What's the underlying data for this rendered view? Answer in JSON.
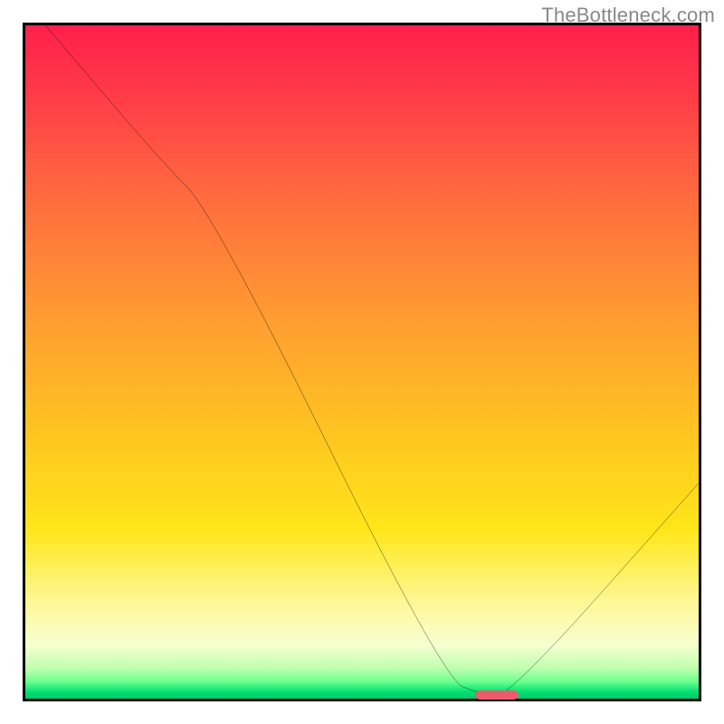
{
  "watermark": "TheBottleneck.com",
  "chart_data": {
    "type": "line",
    "title": "",
    "xlabel": "",
    "ylabel": "",
    "xlim": [
      0,
      100
    ],
    "ylim": [
      0,
      100
    ],
    "x": [
      3,
      20,
      28,
      62,
      68,
      72,
      100
    ],
    "y": [
      100,
      80,
      72,
      3,
      0.5,
      0.5,
      32
    ],
    "note": "y is percent of plot height from bottom; curve is a bottleneck/mismatch profile dipping to a green optimum band near x≈68–72",
    "marker": {
      "x_center": 70,
      "width_pct": 6.5,
      "y": 0.5
    }
  },
  "colors": {
    "gradient_top": "#ff1f4b",
    "gradient_mid": "#ffe61a",
    "gradient_bottom": "#00c96e",
    "curve": "#000000",
    "marker": "#ef5b6b",
    "border": "#000000",
    "watermark": "#888888"
  }
}
